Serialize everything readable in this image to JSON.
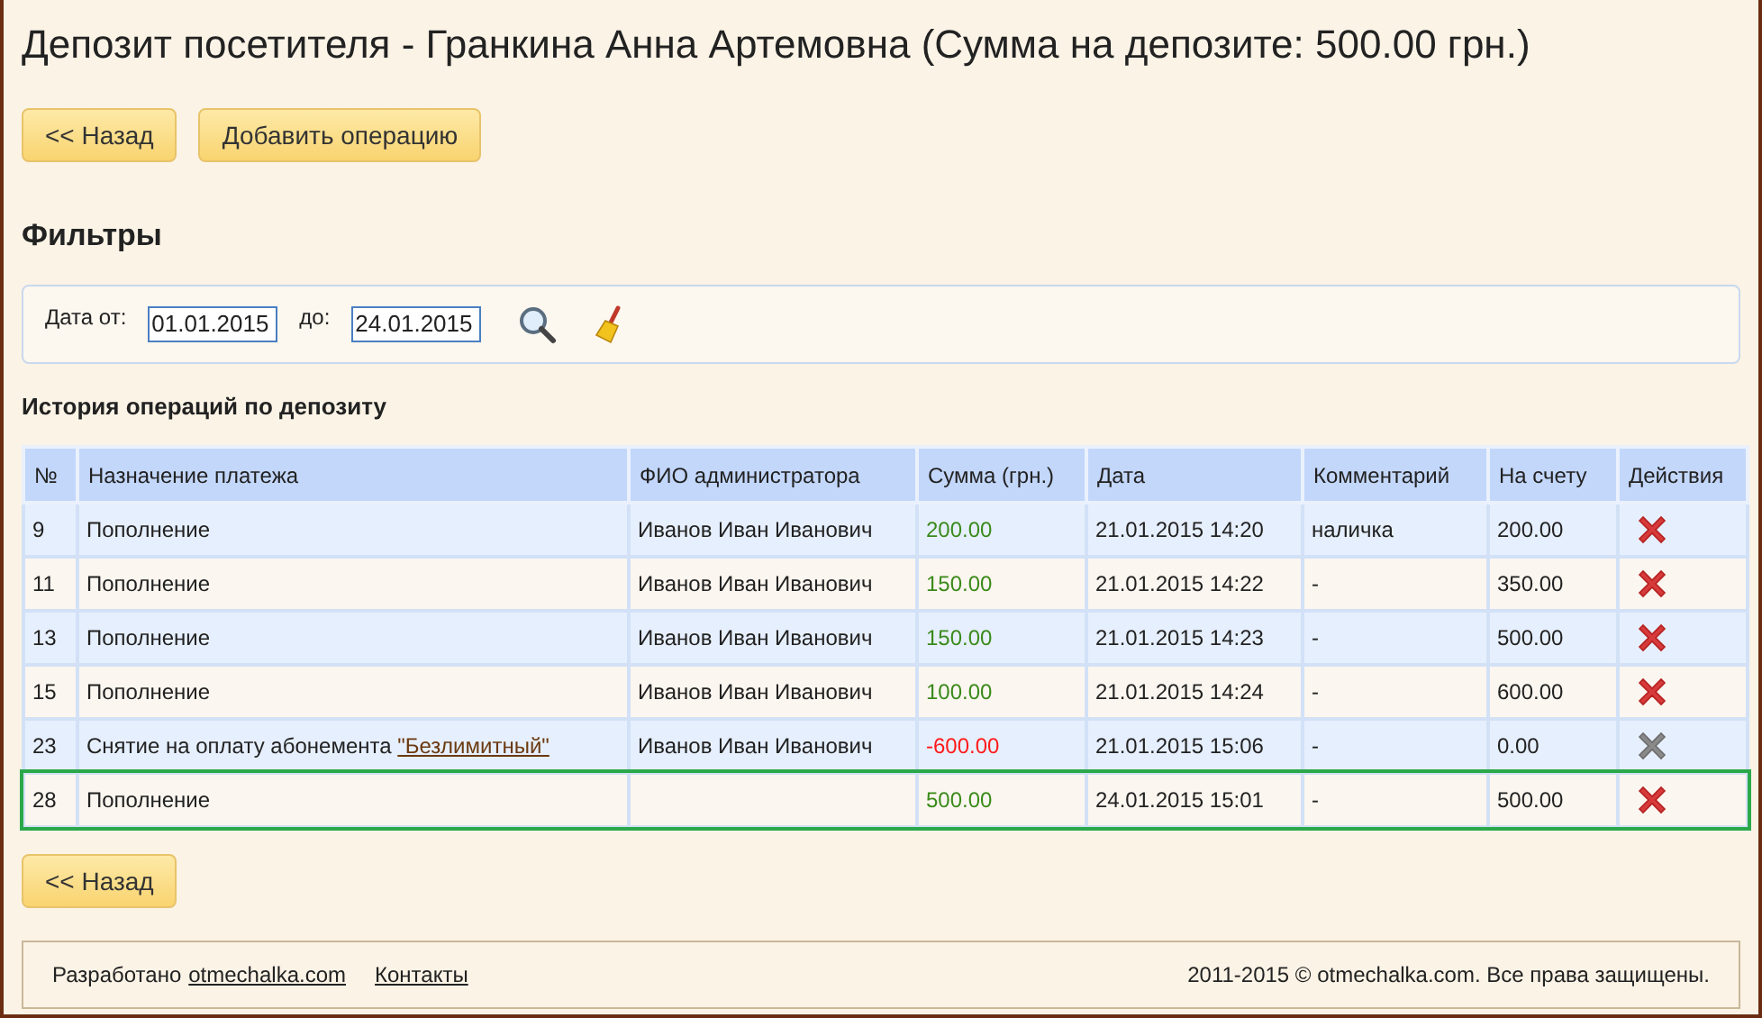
{
  "title": "Депозит посетителя - Гранкина Анна Артемовна (Сумма на депозите: 500.00 грн.)",
  "top_buttons": [
    "<< Назад",
    "Добавить операцию"
  ],
  "filters": {
    "heading": "Фильтры",
    "from_label": "Дата от:",
    "from_value": "01.01.2015",
    "to_label": "до:",
    "to_value": "24.01.2015"
  },
  "history": {
    "heading": "История операций по депозиту",
    "columns": [
      "№",
      "Назначение платежа",
      "ФИО администратора",
      "Сумма (грн.)",
      "Дата",
      "Комментарий",
      "На счету",
      "Действия"
    ],
    "rows": [
      {
        "id": "9",
        "purpose": "Пополнение",
        "admin": "Иванов Иван Иванович",
        "amount": "200.00",
        "color": "#3a8a1a",
        "date": "21.01.2015 14:20",
        "comment": "наличка",
        "balance": "200.00",
        "delete_disabled": false,
        "highlighted": false
      },
      {
        "id": "11",
        "purpose": "Пополнение",
        "admin": "Иванов Иван Иванович",
        "amount": "150.00",
        "color": "#3a8a1a",
        "date": "21.01.2015 14:22",
        "comment": "-",
        "balance": "350.00",
        "delete_disabled": false,
        "highlighted": false
      },
      {
        "id": "13",
        "purpose": "Пополнение",
        "admin": "Иванов Иван Иванович",
        "amount": "150.00",
        "color": "#3a8a1a",
        "date": "21.01.2015 14:23",
        "comment": "-",
        "balance": "500.00",
        "delete_disabled": false,
        "highlighted": false
      },
      {
        "id": "15",
        "purpose": "Пополнение",
        "admin": "Иванов Иван Иванович",
        "amount": "100.00",
        "color": "#3a8a1a",
        "date": "21.01.2015 14:24",
        "comment": "-",
        "balance": "600.00",
        "delete_disabled": false,
        "highlighted": false
      },
      {
        "id": "23",
        "purpose": "Снятие на оплату абонемента",
        "purpose_link": "\"Безлимитный\"",
        "admin": "Иванов Иван Иванович",
        "amount": "-600.00",
        "color": "#ff1a1a",
        "date": "21.01.2015 15:06",
        "comment": "-",
        "balance": "0.00",
        "delete_disabled": true,
        "highlighted": false
      },
      {
        "id": "28",
        "purpose": "Пополнение",
        "amount": "500.00",
        "color": "#3a8a1a",
        "date": "24.01.2015 15:01",
        "comment": "-",
        "balance": "500.00",
        "delete_disabled": false,
        "highlighted": true
      }
    ]
  },
  "bottom_button": "<< Назад",
  "footer": {
    "developed": "Разработано",
    "site_link": "otmechalka.com",
    "contacts": "Контакты",
    "copyright": "2011-2015 © otmechalka.com. Все права защищены."
  }
}
